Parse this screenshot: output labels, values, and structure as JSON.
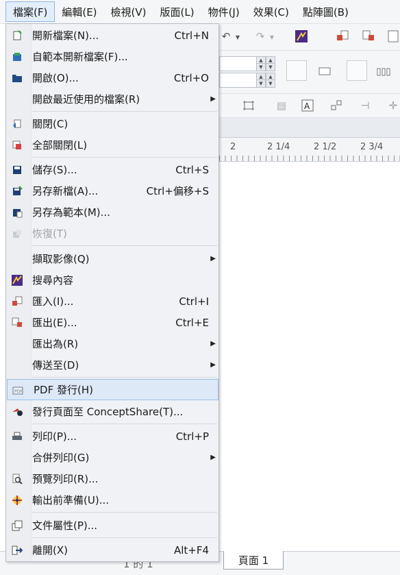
{
  "menubar": {
    "items": [
      {
        "label": "檔案(F)"
      },
      {
        "label": "編輯(E)"
      },
      {
        "label": "檢視(V)"
      },
      {
        "label": "版面(L)"
      },
      {
        "label": "物件(J)"
      },
      {
        "label": "效果(C)"
      },
      {
        "label": "點陣圖(B)"
      }
    ]
  },
  "file_menu": {
    "new": {
      "label": "開新檔案(N)...",
      "shortcut": "Ctrl+N"
    },
    "new_from_template": {
      "label": "自範本開新檔案(F)..."
    },
    "open": {
      "label": "開啟(O)...",
      "shortcut": "Ctrl+O"
    },
    "open_recent": {
      "label": "開啟最近使用的檔案(R)"
    },
    "close": {
      "label": "關閉(C)"
    },
    "close_all": {
      "label": "全部關閉(L)"
    },
    "save": {
      "label": "儲存(S)...",
      "shortcut": "Ctrl+S"
    },
    "save_as": {
      "label": "另存新檔(A)...",
      "shortcut": "Ctrl+偏移+S"
    },
    "save_as_template": {
      "label": "另存為範本(M)..."
    },
    "revert": {
      "label": "恢復(T)",
      "disabled": true
    },
    "acquire_image": {
      "label": "擷取影像(Q)"
    },
    "search_content": {
      "label": "搜尋內容"
    },
    "import": {
      "label": "匯入(I)...",
      "shortcut": "Ctrl+I"
    },
    "export": {
      "label": "匯出(E)...",
      "shortcut": "Ctrl+E"
    },
    "export_for": {
      "label": "匯出為(R)"
    },
    "send_to": {
      "label": "傳送至(D)"
    },
    "publish_pdf": {
      "label": "PDF 發行(H)",
      "highlighted": true
    },
    "publish_conceptshare": {
      "label": "發行頁面至 ConceptShare(T)..."
    },
    "print": {
      "label": "列印(P)...",
      "shortcut": "Ctrl+P"
    },
    "print_merge": {
      "label": "合併列印(G)"
    },
    "print_preview": {
      "label": "預覽列印(R)..."
    },
    "prepress": {
      "label": "輸出前準備(U)..."
    },
    "document_properties": {
      "label": "文件屬性(P)..."
    },
    "exit": {
      "label": "離開(X)",
      "shortcut": "Alt+F4"
    }
  },
  "ruler": {
    "labels": [
      "2",
      "2 1/4",
      "2 1/2",
      "2 3/4"
    ]
  },
  "status": {
    "page_count": "1 的 1",
    "page_tab": "頁面 1"
  },
  "colors": {
    "menu_bg": "#f0f2f5",
    "highlight": "#dde9f7",
    "highlight_border": "#99bfe6",
    "disabled_text": "#a0a4a9"
  }
}
